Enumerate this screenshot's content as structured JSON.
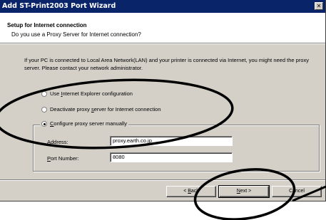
{
  "window": {
    "title": "Add ST-Print2003 Port Wizard",
    "close_label": "✕"
  },
  "header": {
    "title": "Setup for Internet connection",
    "subtitle": "Do you use a Proxy Server for Internet connection?"
  },
  "description": "If your PC is connected to Local Area Network(LAN) and your printer is connected via Internet, you might need the proxy server. Please contact your network administrator.",
  "options": {
    "ie_pre": "Use ",
    "ie_key": "I",
    "ie_post": "nternet Explorer configuration",
    "deactivate_pre": "Deactivate proxy ",
    "deactivate_key": "s",
    "deactivate_post": "erver for Internet connection",
    "manual_pre": "",
    "manual_key": "C",
    "manual_post": "onfigure proxy server manually",
    "selected": "manual"
  },
  "proxy": {
    "address_pre": "",
    "address_key": "A",
    "address_post": "ddress:",
    "address_value": "proxy.earth.co.jp",
    "port_pre": "",
    "port_key": "P",
    "port_post": "ort Number:",
    "port_value": "8080"
  },
  "buttons": {
    "back_pre": "< ",
    "back_key": "B",
    "back_post": "ack",
    "next_pre": "",
    "next_key": "N",
    "next_post": "ext >",
    "cancel": "Cancel"
  }
}
